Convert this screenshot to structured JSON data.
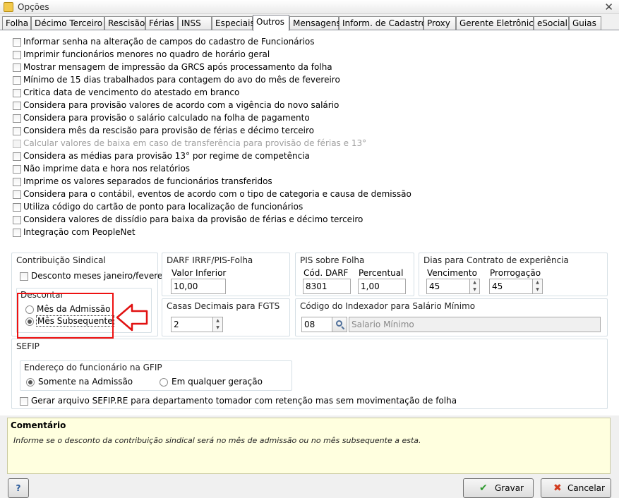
{
  "window": {
    "title": "Opções",
    "close_glyph": "✕"
  },
  "tabs": [
    {
      "label": "Folha"
    },
    {
      "label": "Décimo Terceiro"
    },
    {
      "label": "Rescisão"
    },
    {
      "label": "Férias"
    },
    {
      "label": "INSS"
    },
    {
      "label": "Especiais"
    },
    {
      "label": "Outros",
      "active": true
    },
    {
      "label": "Mensagens"
    },
    {
      "label": "Inform. de Cadastro"
    },
    {
      "label": "Proxy"
    },
    {
      "label": "Gerente Eletrônico"
    },
    {
      "label": "eSocial"
    },
    {
      "label": "Guias"
    }
  ],
  "options": [
    {
      "label": "Informar senha na alteração de campos do cadastro de Funcionários"
    },
    {
      "label": "Imprimir funcionários menores no quadro de horário geral"
    },
    {
      "label": "Mostrar mensagem de impressão da GRCS após processamento da folha"
    },
    {
      "label": "Mínimo de 15 dias trabalhados para contagem do avo do mês de fevereiro"
    },
    {
      "label": "Critica data de vencimento do atestado em branco"
    },
    {
      "label": "Considera para provisão valores de acordo com a vigência do novo salário"
    },
    {
      "label": "Considera para provisão o salário calculado na folha de pagamento"
    },
    {
      "label": "Considera mês da rescisão para provisão de férias e décimo terceiro"
    },
    {
      "label": "Calcular valores de baixa em caso de transferência para provisão de férias e 13°",
      "disabled": true
    },
    {
      "label": "Considera as médias para provisão 13° por regime de competência"
    },
    {
      "label": "Não imprime data e hora nos relatórios"
    },
    {
      "label": "Imprime os valores separados de funcionários transferidos"
    },
    {
      "label": "Considera para o contábil, eventos de acordo com o tipo de categoria e causa de demissão"
    },
    {
      "label": "Utiliza código do cartão de ponto para localização de funcionários"
    },
    {
      "label": "Considera valores de dissídio para baixa da provisão de férias e décimo terceiro"
    },
    {
      "label": "Integração com PeopleNet"
    }
  ],
  "contribuicao": {
    "title": "Contribuição Sindical",
    "desconto_meses_label": "Desconto meses janeiro/fevereiro",
    "descontar_title": "Descontar",
    "mes_admissao_label": "Mês da Admissão",
    "mes_subsequente_label": "Mês Subsequente",
    "selected": "mes_subsequente"
  },
  "darf": {
    "title": "DARF IRRF/PIS-Folha",
    "valor_inferior_label": "Valor Inferior",
    "valor_inferior_value": "10,00"
  },
  "casas_decimais": {
    "title": "Casas Decimais para FGTS",
    "value": "2"
  },
  "pis": {
    "title": "PIS sobre Folha",
    "cod_darf_label": "Cód. DARF",
    "cod_darf_value": "8301",
    "percentual_label": "Percentual",
    "percentual_value": "1,00"
  },
  "dias_contrato": {
    "title": "Dias para Contrato de experiência",
    "vencimento_label": "Vencimento",
    "vencimento_value": "45",
    "prorrogacao_label": "Prorrogação",
    "prorrogacao_value": "45"
  },
  "indexador": {
    "title": "Código do Indexador para Salário Mínimo",
    "code_value": "08",
    "description_value": "Salario Mínimo"
  },
  "sefip": {
    "title": "SEFIP",
    "endereco_title": "Endereço do funcionário na GFIP",
    "somente_admissao_label": "Somente na Admissão",
    "qualquer_geracao_label": "Em qualquer geração",
    "selected": "somente_admissao",
    "gerar_arquivo_label": "Gerar arquivo SEFIP.RE para departamento tomador com retenção mas sem movimentação de folha"
  },
  "comentario": {
    "title": "Comentário",
    "text": "Informe se o desconto da contribuição sindical será no mês de admissão ou no mês subsequente a esta."
  },
  "footer": {
    "help_label": "?",
    "gravar_label": "Gravar",
    "cancelar_label": "Cancelar"
  },
  "colors": {
    "highlight": "#e11111",
    "comment_bg": "#ffffdf"
  },
  "icons": {
    "help": "help-icon",
    "gravar": "check-icon",
    "cancelar": "x-icon",
    "search": "search-icon"
  }
}
